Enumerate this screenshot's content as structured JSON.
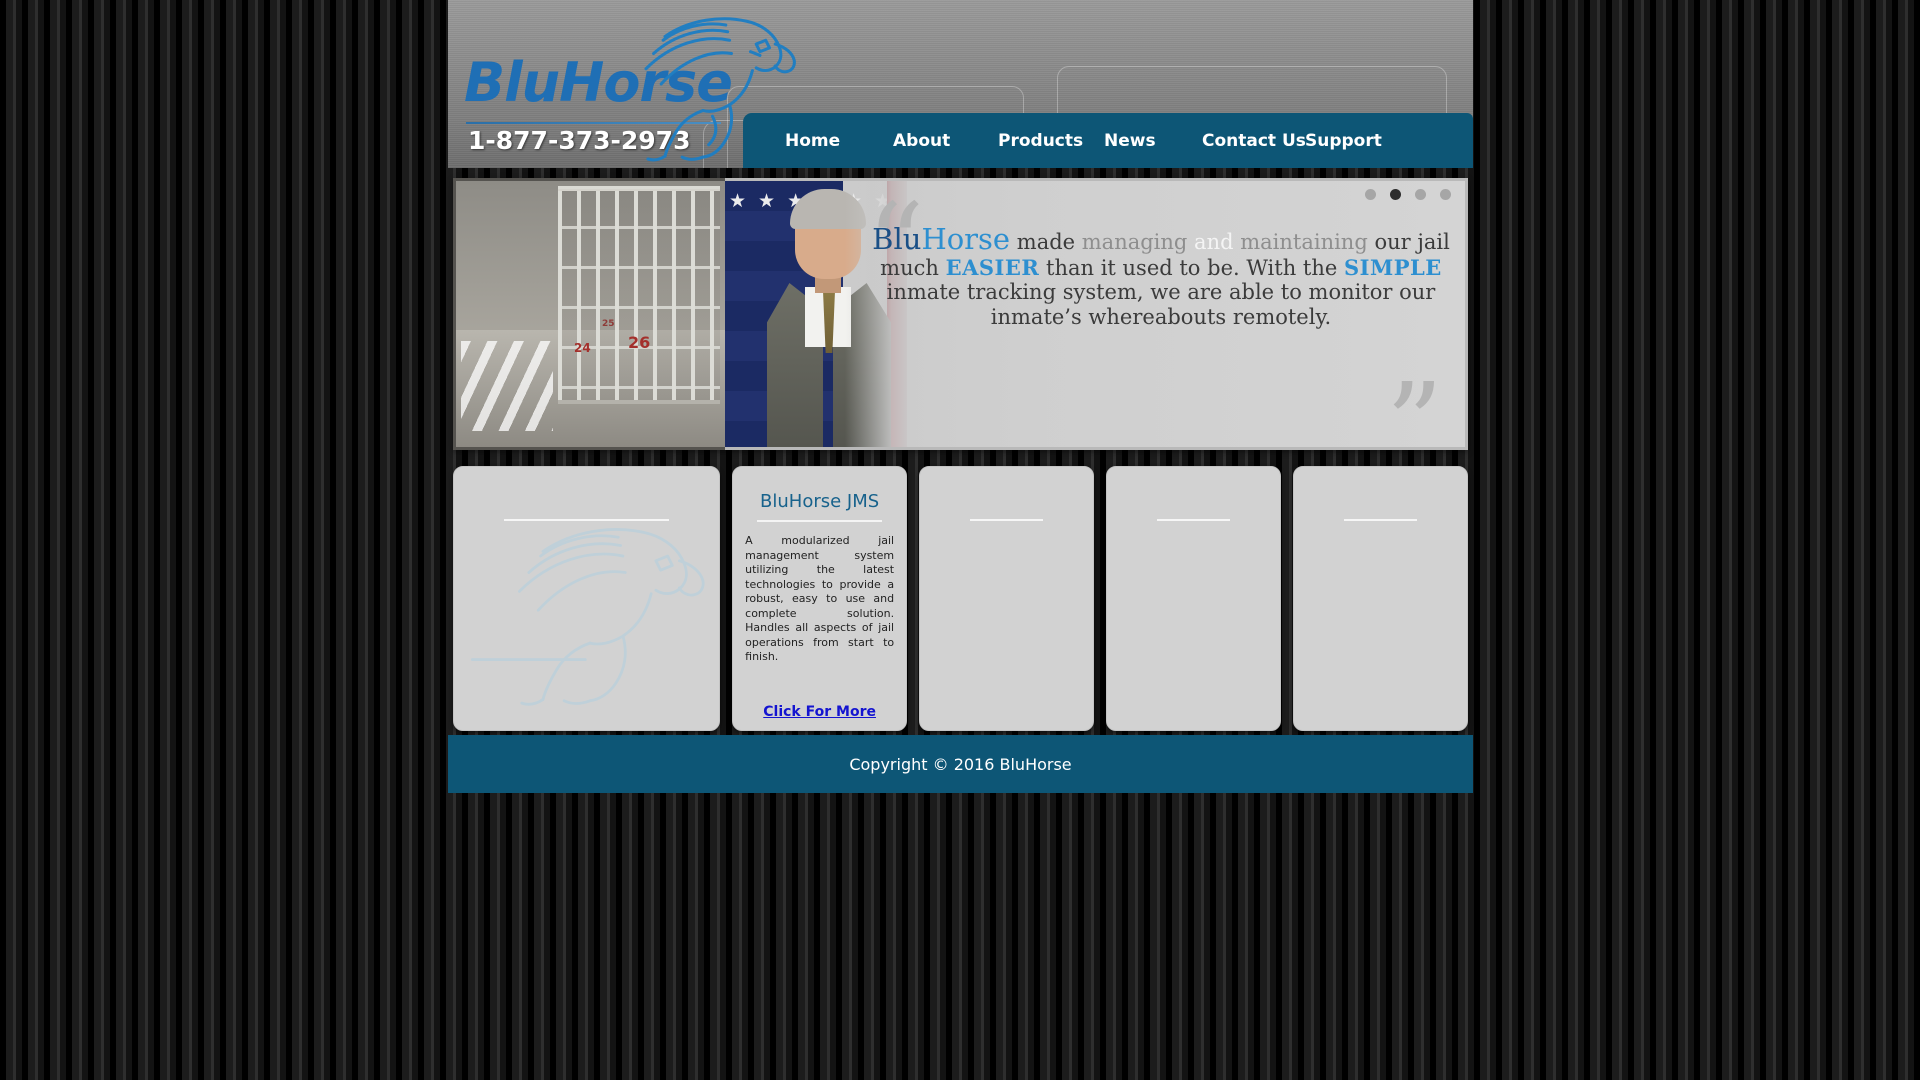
{
  "site": {
    "logo_text_blu": "Blu",
    "logo_text_horse": "Horse",
    "phone": "1-877-373-2973",
    "horse_icon": "running-horse-logo-icon"
  },
  "nav": {
    "items": [
      {
        "label": "Home"
      },
      {
        "label": "About"
      },
      {
        "label": "Products"
      },
      {
        "label": "News"
      },
      {
        "label": "Contact Us"
      },
      {
        "label": "Support"
      }
    ]
  },
  "banner": {
    "photo_left_alt": "jail-cell-corridor-photo",
    "photo_person_alt": "sheriff-portrait-with-us-flag-photo",
    "cell_numbers": {
      "a": "24",
      "b": "26",
      "c": "25"
    },
    "quote_open": "“",
    "quote_close": "”",
    "quote": {
      "brand_blu": "Blu",
      "brand_horse": "Horse",
      "seg_made": " made ",
      "seg_managing": "managing",
      "seg_and": " and ",
      "seg_maintaining": "maintaining",
      "line2_pre": "our jail much ",
      "line2_hl": "EASIER",
      "line2_post": " than it used to be. With the",
      "line3_hl": "SIMPLE",
      "line3_post": " inmate tracking system, we are able to",
      "line4": "monitor our inmate’s whereabouts remotely."
    },
    "dots": [
      {
        "active": false
      },
      {
        "active": true
      },
      {
        "active": false
      },
      {
        "active": false
      }
    ]
  },
  "cards": [
    {
      "title": "",
      "body": "",
      "link": "",
      "watermark": "bluhorse-horse-watermark-icon"
    },
    {
      "title": "BluHorse JMS",
      "body": "A modularized jail management system utilizing the latest technologies to provide a robust, easy to use and complete solution. Handles all aspects of jail operations from start to finish.",
      "link": "Click For More",
      "watermark": ""
    },
    {
      "title": "",
      "body": "",
      "link": "",
      "watermark": ""
    },
    {
      "title": "",
      "body": "",
      "link": "",
      "watermark": ""
    },
    {
      "title": "",
      "body": "",
      "link": "",
      "watermark": ""
    }
  ],
  "footer": {
    "copyright": "Copyright © 2016 BluHorse"
  },
  "colors": {
    "brand_teal": "#0d5676",
    "brand_blue": "#1f6fb5",
    "accent_light_blue": "#2d8fd0",
    "link_blue": "#1414d0",
    "card_bg": "#d2d2d2"
  }
}
